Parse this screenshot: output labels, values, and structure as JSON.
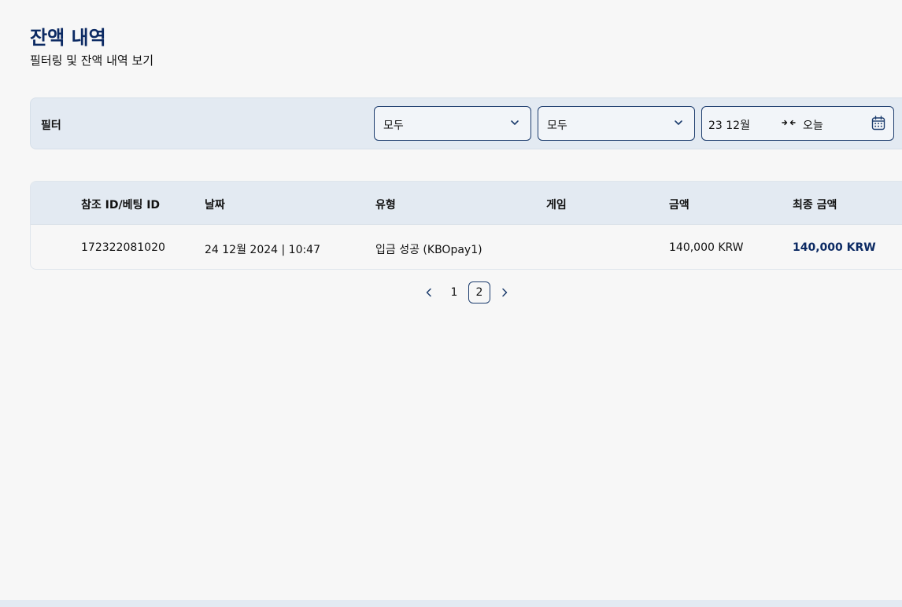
{
  "header": {
    "title": "잔액 내역",
    "subtitle": "필터링 및 잔액 내역 보기"
  },
  "filters": {
    "label": "필터",
    "select1_value": "모두",
    "select2_value": "모두",
    "date_from": "23 12월",
    "date_to": "오늘"
  },
  "table": {
    "headers": [
      "참조 ID/베팅 ID",
      "날짜",
      "유형",
      "게임",
      "금액",
      "최종 금액"
    ],
    "rows": [
      [
        "172322081020",
        "24 12월 2024 | 10:47",
        "입금 성공 (KBOpay1)",
        "",
        "140,000 KRW",
        "140,000 KRW"
      ]
    ]
  },
  "pagination": {
    "pages": [
      "1",
      "2"
    ],
    "current": "2"
  },
  "colors": {
    "accent": "#0c2a63",
    "border": "#1d3d6e",
    "filter_bg": "#e3eaf2"
  }
}
